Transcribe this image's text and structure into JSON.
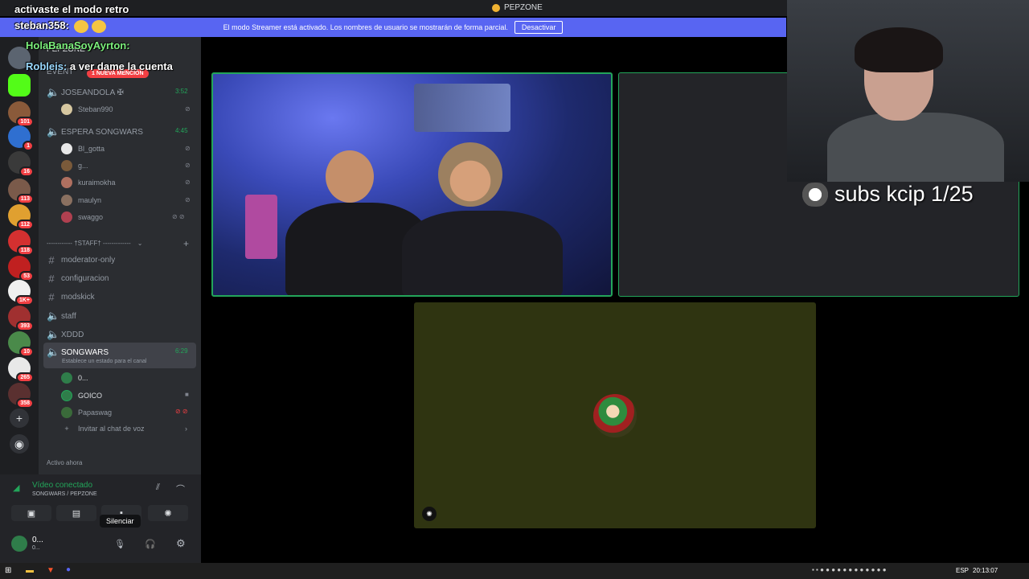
{
  "window": {
    "title": "PEPZONE"
  },
  "banner": {
    "text": "El modo Streamer está activado. Los nombres de usuario se mostrarán de forma parcial.",
    "button": "Desactivar"
  },
  "chat_overlay": [
    {
      "user": "",
      "message": "activaste el modo retro",
      "color": "#ffffff"
    },
    {
      "user": "steban358:",
      "message": "",
      "color": "#ffffff"
    },
    {
      "user": "HolaBanaSoyAyrton:",
      "message": "",
      "color": "#7cf07c"
    },
    {
      "user": "Robleis:",
      "message": "a ver dame la cuenta",
      "color": "#9ad9ff"
    }
  ],
  "server_badges": [
    "101",
    "1",
    "16",
    "113",
    "112",
    "118",
    "53",
    "1K+",
    "393",
    "10",
    "265",
    "358"
  ],
  "channels": {
    "server_name": "PEPZONE",
    "events_label": "EVENT",
    "mention_badge": "1 NUEVA MENCIÓN",
    "voice1": {
      "name": "JOSEANDOLA ✠",
      "timer": "3:52",
      "users": [
        "Steban990"
      ]
    },
    "voice2": {
      "name": "ESPERA SONGWARS",
      "timer": "4:45",
      "users": [
        "Bl_gotta",
        "g...",
        "kuraimokha",
        "maulyn",
        "swaggo"
      ]
    },
    "category": "------------ †STAFF† -------------",
    "text_channels": [
      "moderator-only",
      "configuracion",
      "modskick"
    ],
    "voice_plain": [
      "staff",
      "XDDD"
    ],
    "active_voice": {
      "name": "SONGWARS",
      "timer": "6:29",
      "status": "Establece un estado para el canal",
      "users": [
        "0...",
        "GOICO",
        "Papaswag"
      ]
    },
    "invite": "Invitar al chat de voz",
    "active_now": "Activo ahora"
  },
  "voice_panel": {
    "status": "Vídeo conectado",
    "sub": "SONGWARS / PEPZONE",
    "tooltip": "Silenciar",
    "user": "0...",
    "user_sub": "0..."
  },
  "overlay": {
    "subs_text": "subs kcip 1/25"
  },
  "taskbar": {
    "lang": "ESP",
    "time": "20:13:07"
  },
  "colors": {
    "accent": "#5865f2",
    "connected": "#23a55a",
    "danger": "#f23f43"
  }
}
